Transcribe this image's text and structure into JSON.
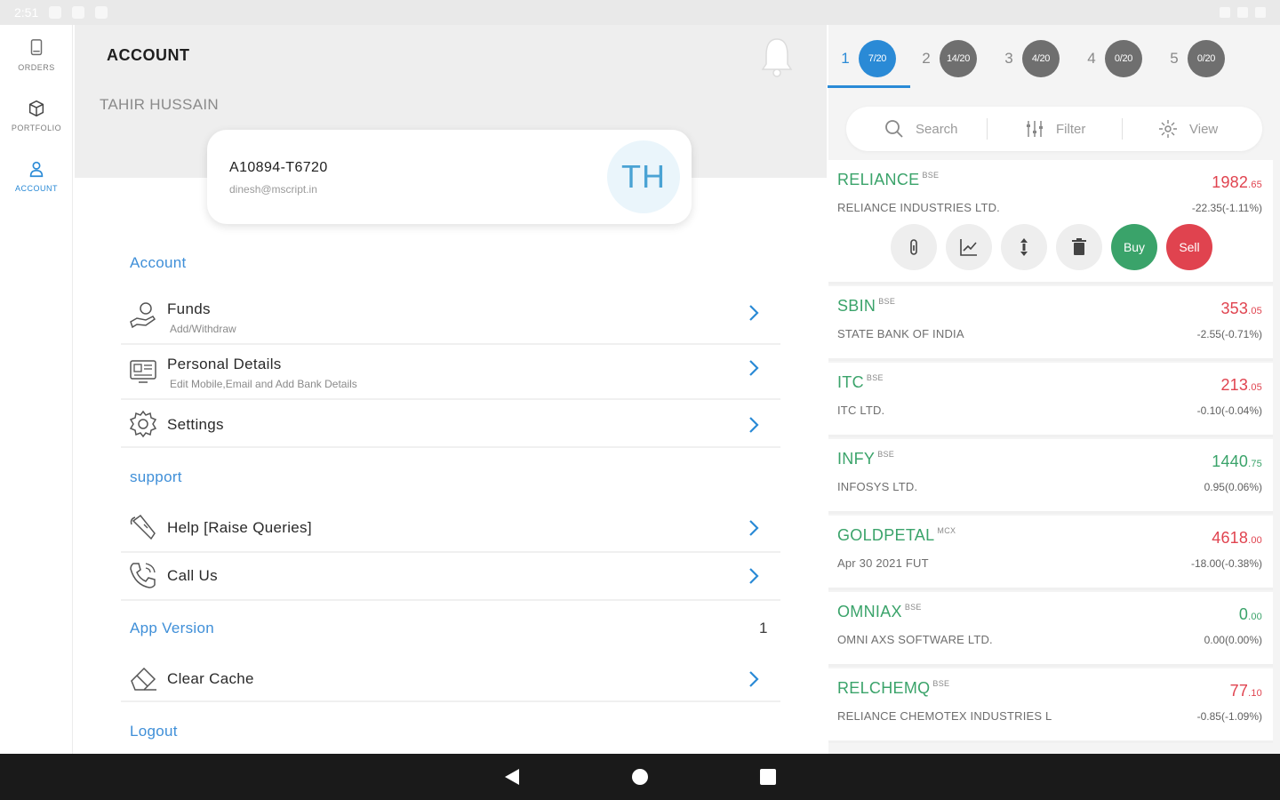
{
  "status_bar": {
    "time": "2:51"
  },
  "nav": [
    {
      "label": "ORDERS",
      "icon": "orders-icon"
    },
    {
      "label": "PORTFOLIO",
      "icon": "portfolio-icon"
    },
    {
      "label": "ACCOUNT",
      "icon": "account-icon",
      "active": true
    }
  ],
  "header": {
    "title": "ACCOUNT",
    "bell_icon": "bell-icon"
  },
  "user": {
    "name": "TAHIR HUSSAIN",
    "client_code": "A10894-T6720",
    "email": "dinesh@mscript.in",
    "initials": "TH"
  },
  "sections": {
    "account": "Account",
    "support": "support",
    "app_version": "App Version",
    "logout": "Logout"
  },
  "menu": {
    "funds": {
      "title": "Funds",
      "subtitle": "Add/Withdraw",
      "icon": "funds-icon"
    },
    "personal": {
      "title": "Personal Details",
      "subtitle": "Edit Mobile,Email and Add Bank Details",
      "icon": "personal-details-icon"
    },
    "settings": {
      "title": "Settings",
      "icon": "gear-icon"
    },
    "help": {
      "title": "Help [Raise Queries]",
      "icon": "help-icon"
    },
    "call": {
      "title": "Call Us",
      "icon": "phone-icon"
    },
    "clear_cache": {
      "title": "Clear Cache",
      "icon": "eraser-icon"
    }
  },
  "app_version_value": "1",
  "watchlist_tabs": [
    {
      "num": "1",
      "badge": "7/20",
      "active": true
    },
    {
      "num": "2",
      "badge": "14/20"
    },
    {
      "num": "3",
      "badge": "4/20"
    },
    {
      "num": "4",
      "badge": "0/20"
    },
    {
      "num": "5",
      "badge": "0/20"
    }
  ],
  "toolbar": {
    "search": "Search",
    "filter": "Filter",
    "view": "View"
  },
  "actions": {
    "buy": "Buy",
    "sell": "Sell"
  },
  "watchlist": [
    {
      "symbol": "RELIANCE",
      "exchange": "BSE",
      "name": "RELIANCE INDUSTRIES LTD.",
      "price": "1982",
      "price_decimals": ".65",
      "change": "-22.35(-1.11%)",
      "trend": "down"
    },
    {
      "symbol": "SBIN",
      "exchange": "BSE",
      "name": "STATE BANK OF INDIA",
      "price": "353",
      "price_decimals": ".05",
      "change": "-2.55(-0.71%)",
      "trend": "down"
    },
    {
      "symbol": "ITC",
      "exchange": "BSE",
      "name": "ITC LTD.",
      "price": "213",
      "price_decimals": ".05",
      "change": "-0.10(-0.04%)",
      "trend": "down"
    },
    {
      "symbol": "INFY",
      "exchange": "BSE",
      "name": "INFOSYS LTD.",
      "price": "1440",
      "price_decimals": ".75",
      "change": "0.95(0.06%)",
      "trend": "up"
    },
    {
      "symbol": "GOLDPETAL",
      "exchange": "MCX",
      "name": "Apr 30 2021 FUT",
      "price": "4618",
      "price_decimals": ".00",
      "change": "-18.00(-0.38%)",
      "trend": "down"
    },
    {
      "symbol": "OMNIAX",
      "exchange": "BSE",
      "name": "OMNI AXS SOFTWARE LTD.",
      "price": "0",
      "price_decimals": ".00",
      "change": "0.00(0.00%)",
      "trend": "up"
    },
    {
      "symbol": "RELCHEMQ",
      "exchange": "BSE",
      "name": "RELIANCE CHEMOTEX INDUSTRIES L",
      "price": "77",
      "price_decimals": ".10",
      "change": "-0.85(-1.09%)",
      "trend": "down"
    }
  ],
  "colors": {
    "accent": "#2a8ad6",
    "green": "#3aa36a",
    "red": "#e0434f"
  }
}
